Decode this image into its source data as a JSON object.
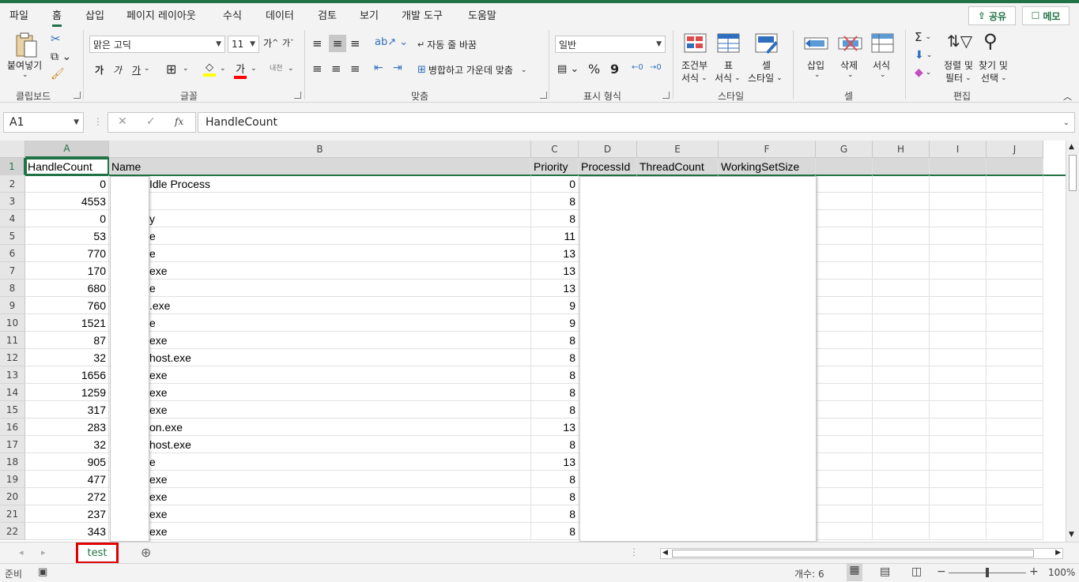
{
  "menu": {
    "tabs": [
      "파일",
      "홈",
      "삽입",
      "페이지 레이아웃",
      "수식",
      "데이터",
      "검토",
      "보기",
      "개발 도구",
      "도움말"
    ],
    "share": "공유",
    "memo": "메모"
  },
  "ribbon": {
    "clipboard": {
      "paste": "붙여넣기",
      "label": "클립보드"
    },
    "font": {
      "name": "맑은 고딕",
      "size": "11",
      "label": "글꼴",
      "bold": "가",
      "italic": "가",
      "underline": "가",
      "grow": "가",
      "shrink": "가",
      "font_color_glyph": "가",
      "phonetic": "내천"
    },
    "alignment": {
      "wrap": "자동 줄 바꿈",
      "merge": "병합하고 가운데 맞춤",
      "label": "맞춤"
    },
    "number": {
      "format": "일반",
      "label": "표시 형식",
      "percent": "%",
      "comma": "9"
    },
    "styles": {
      "conditional": "조건부\n서식",
      "conditional_l1": "조건부",
      "conditional_l2": "서식",
      "table_l1": "표",
      "table_l2": "서식",
      "cell_l1": "셀",
      "cell_l2": "스타일",
      "label": "스타일"
    },
    "cells": {
      "insert": "삽입",
      "delete": "삭제",
      "format": "서식",
      "label": "셀"
    },
    "editing": {
      "sort_l1": "정렬 및",
      "sort_l2": "필터",
      "find_l1": "찾기 및",
      "find_l2": "선택",
      "label": "편집",
      "sum": "Σ"
    }
  },
  "formula_bar": {
    "name_box": "A1",
    "formula": "HandleCount",
    "fx": "fx"
  },
  "columns": [
    "A",
    "B",
    "C",
    "D",
    "E",
    "F",
    "G",
    "H",
    "I",
    "J"
  ],
  "header_row": [
    "HandleCount",
    "Name",
    "Priority",
    "ProcessId",
    "ThreadCount",
    "WorkingSetSize"
  ],
  "rows": [
    {
      "n": "2",
      "handle": "0",
      "name": "Idle Process",
      "priority": "0"
    },
    {
      "n": "3",
      "handle": "4553",
      "name": "",
      "priority": "8"
    },
    {
      "n": "4",
      "handle": "0",
      "name": "y",
      "priority": "8"
    },
    {
      "n": "5",
      "handle": "53",
      "name": "e",
      "priority": "11"
    },
    {
      "n": "6",
      "handle": "770",
      "name": "e",
      "priority": "13"
    },
    {
      "n": "7",
      "handle": "170",
      "name": "exe",
      "priority": "13"
    },
    {
      "n": "8",
      "handle": "680",
      "name": "e",
      "priority": "13"
    },
    {
      "n": "9",
      "handle": "760",
      "name": ".exe",
      "priority": "9"
    },
    {
      "n": "10",
      "handle": "1521",
      "name": "e",
      "priority": "9"
    },
    {
      "n": "11",
      "handle": "87",
      "name": "exe",
      "priority": "8"
    },
    {
      "n": "12",
      "handle": "32",
      "name": "host.exe",
      "priority": "8"
    },
    {
      "n": "13",
      "handle": "1656",
      "name": "exe",
      "priority": "8"
    },
    {
      "n": "14",
      "handle": "1259",
      "name": "exe",
      "priority": "8"
    },
    {
      "n": "15",
      "handle": "317",
      "name": "exe",
      "priority": "8"
    },
    {
      "n": "16",
      "handle": "283",
      "name": "on.exe",
      "priority": "13"
    },
    {
      "n": "17",
      "handle": "32",
      "name": "host.exe",
      "priority": "8"
    },
    {
      "n": "18",
      "handle": "905",
      "name": "e",
      "priority": "13"
    },
    {
      "n": "19",
      "handle": "477",
      "name": "exe",
      "priority": "8"
    },
    {
      "n": "20",
      "handle": "272",
      "name": "exe",
      "priority": "8"
    },
    {
      "n": "21",
      "handle": "237",
      "name": "exe",
      "priority": "8"
    },
    {
      "n": "22",
      "handle": "343",
      "name": "exe",
      "priority": "8"
    }
  ],
  "sheet_tab": "test",
  "status": {
    "ready": "준비",
    "count": "개수: 6",
    "zoom": "100%"
  },
  "colors": {
    "accent": "#217346",
    "tab_highlight": "#e00000"
  }
}
